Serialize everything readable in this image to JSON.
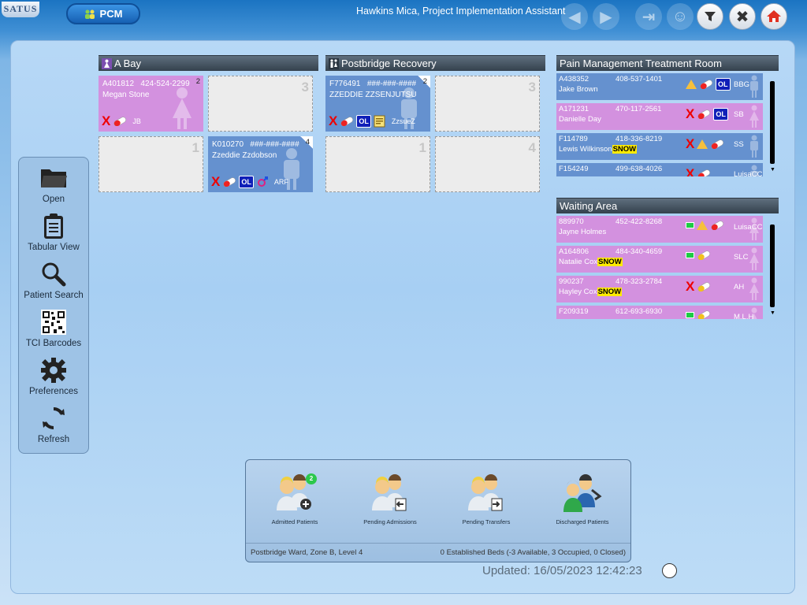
{
  "header": {
    "logo": "SATUS",
    "app_button": "PCM",
    "user": "Hawkins Mica, Project Implementation Assistant",
    "nav_icons": [
      "back-arrow-icon",
      "forward-arrow-icon",
      "logout-icon",
      "users-icon",
      "filter-icon",
      "close-icon",
      "home-icon"
    ]
  },
  "leftnav": {
    "items": [
      {
        "label": "Open",
        "icon": "folder-icon"
      },
      {
        "label": "Tabular View",
        "icon": "clipboard-icon"
      },
      {
        "label": "Patient Search",
        "icon": "magnifier-icon"
      },
      {
        "label": "TCI Barcodes",
        "icon": "qr-code-icon"
      },
      {
        "label": "Preferences",
        "icon": "gear-icon"
      },
      {
        "label": "Refresh",
        "icon": "refresh-icon"
      }
    ]
  },
  "bays": {
    "a_bay": {
      "title": "A Bay",
      "beds": [
        {
          "id": "A401812",
          "phone": "424-524-2299",
          "name": "Megan Stone",
          "num": "2",
          "color": "pink",
          "x": true,
          "pill": true,
          "ol": false,
          "gender": false,
          "note": false,
          "tag": "JB"
        },
        {
          "num": "3",
          "empty": true
        },
        {
          "num": "1",
          "empty": true
        },
        {
          "id": "K010270",
          "phone": "###-###-####",
          "name": "Zzeddie Zzdobson",
          "num": "4",
          "color": "blue",
          "x": true,
          "pill": true,
          "ol": true,
          "gender": true,
          "note": false,
          "tag": "ARF"
        }
      ]
    },
    "postbridge": {
      "title": "Postbridge Recovery",
      "beds": [
        {
          "id": "F776491",
          "phone": "###-###-####",
          "name": "ZZEDDIE ZZSENJUTSU",
          "num": "2",
          "color": "blue",
          "x": true,
          "pill": true,
          "ol": true,
          "gender": false,
          "note": true,
          "tag": "ZzsueZ"
        },
        {
          "num": "3",
          "empty": true
        },
        {
          "num": "1",
          "empty": true
        },
        {
          "num": "4",
          "empty": true
        }
      ]
    }
  },
  "treatment_room": {
    "title": "Pain Management Treatment Room",
    "patients": [
      {
        "id": "A438352",
        "phone": "408-537-1401",
        "name": "Jake Brown",
        "color": "blue",
        "x": false,
        "warn": true,
        "pill": true,
        "ol": true,
        "grn": false,
        "initials": "BBG",
        "snow": false
      },
      {
        "id": "A171231",
        "phone": "470-117-2561",
        "name": "Danielle Day",
        "color": "pink",
        "x": true,
        "warn": false,
        "pill": true,
        "ol": true,
        "grn": false,
        "initials": "SB",
        "snow": false
      },
      {
        "id": "F114789",
        "phone": "418-336-8219",
        "name": "Lewis Wilkinson",
        "color": "blue",
        "x": true,
        "warn": true,
        "pill": true,
        "ol": false,
        "grn": false,
        "initials": "SS",
        "snow": true
      },
      {
        "id": "F154249",
        "phone": "499-638-4026",
        "name": "",
        "color": "blue",
        "x": true,
        "warn": false,
        "pill": true,
        "ol": false,
        "grn": false,
        "initials": "LuisaCC",
        "snow": false
      }
    ]
  },
  "waiting_area": {
    "title": "Waiting Area",
    "patients": [
      {
        "id": "889970",
        "phone": "452-422-8268",
        "name": "Jayne Holmes",
        "color": "pink",
        "x": false,
        "warn": true,
        "pill": true,
        "ol": false,
        "grn": true,
        "initials": "LuisaCC",
        "snow": false
      },
      {
        "id": "A164806",
        "phone": "484-340-4659",
        "name": "Natalie Cox",
        "color": "pink",
        "x": false,
        "warn": false,
        "pill": true,
        "ol": false,
        "grn": true,
        "initials": "SLC",
        "snow": true
      },
      {
        "id": "990237",
        "phone": "478-323-2784",
        "name": "Hayley Cox",
        "color": "pink",
        "x": true,
        "warn": false,
        "pill": true,
        "ol": false,
        "grn": false,
        "initials": "AH",
        "snow": true
      },
      {
        "id": "F209319",
        "phone": "612-693-6930",
        "name": "",
        "color": "pink",
        "x": false,
        "warn": false,
        "pill": true,
        "ol": false,
        "grn": true,
        "initials": "M.L.H",
        "snow": false
      }
    ]
  },
  "snow_label": "SNOW",
  "ol_label": "OL",
  "x_label": "X",
  "bottom_panel": {
    "buttons": [
      {
        "label": "Admitted Patients",
        "icon": "admitted-patients-icon",
        "badge": "2"
      },
      {
        "label": "Pending Admissions",
        "icon": "pending-admissions-icon"
      },
      {
        "label": "Pending Transfers",
        "icon": "pending-transfers-icon"
      },
      {
        "label": "Discharged Patients",
        "icon": "discharged-patients-icon"
      }
    ],
    "location": "Postbridge Ward, Zone B, Level 4",
    "beds_status": "0 Established Beds (-3 Available, 3 Occupied, 0 Closed)"
  },
  "updated": "Updated: 16/05/2023 12:42:23",
  "colors": {
    "pink": "#d391df",
    "blue": "#6591cf",
    "header": "#3a4753",
    "accent": "#1660b3"
  }
}
